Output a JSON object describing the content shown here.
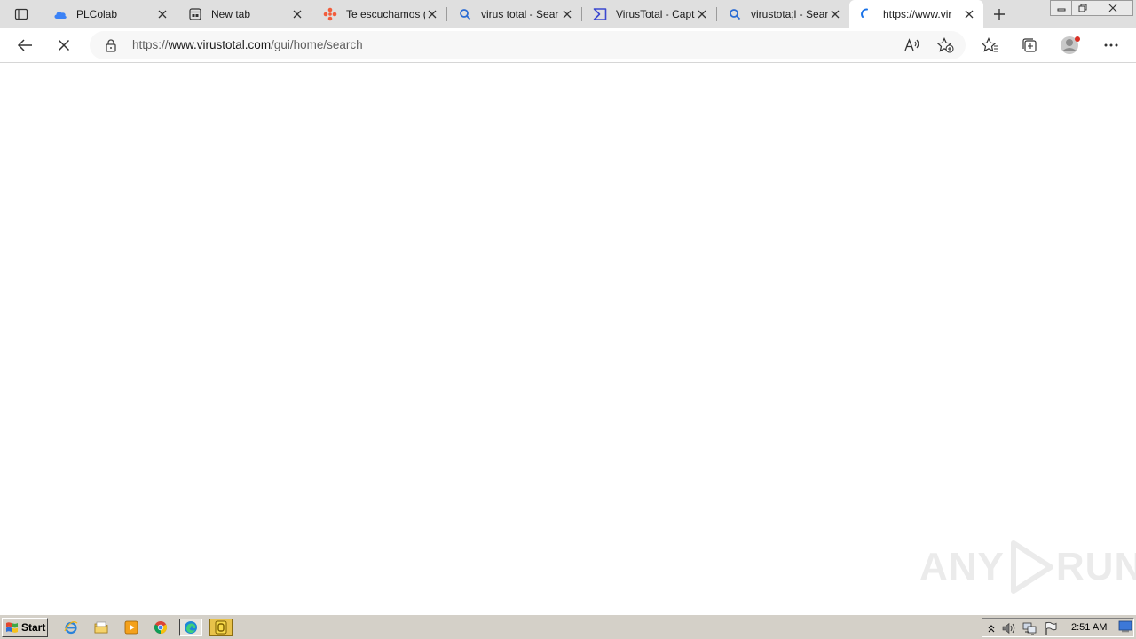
{
  "tabs": [
    {
      "title": "PLColab",
      "icon": "cloud-icon",
      "active": false
    },
    {
      "title": "New tab",
      "icon": "newtab-page-icon",
      "active": false
    },
    {
      "title": "Te escuchamos (",
      "icon": "dots-logo-icon",
      "active": false
    },
    {
      "title": "virus total - Sear",
      "icon": "search-icon",
      "active": false
    },
    {
      "title": "VirusTotal - Capt",
      "icon": "virustotal-logo-icon",
      "active": false
    },
    {
      "title": "virustota;l - Sear",
      "icon": "search-icon",
      "active": false
    },
    {
      "title": "https://www.vir",
      "icon": "loading-spinner-icon",
      "active": true
    }
  ],
  "address_bar": {
    "url_prefix": "https://",
    "url_host": "www.virustotal.com",
    "url_path": "/gui/home/search"
  },
  "watermark": {
    "text_left": "ANY",
    "text_right": "RUN"
  },
  "taskbar": {
    "start_label": "Start",
    "clock": "2:51 AM"
  },
  "colors": {
    "tabstrip_bg": "#dfdfdf",
    "taskbar_bg": "#d4d0c8",
    "accent_blue": "#1a73e8"
  }
}
